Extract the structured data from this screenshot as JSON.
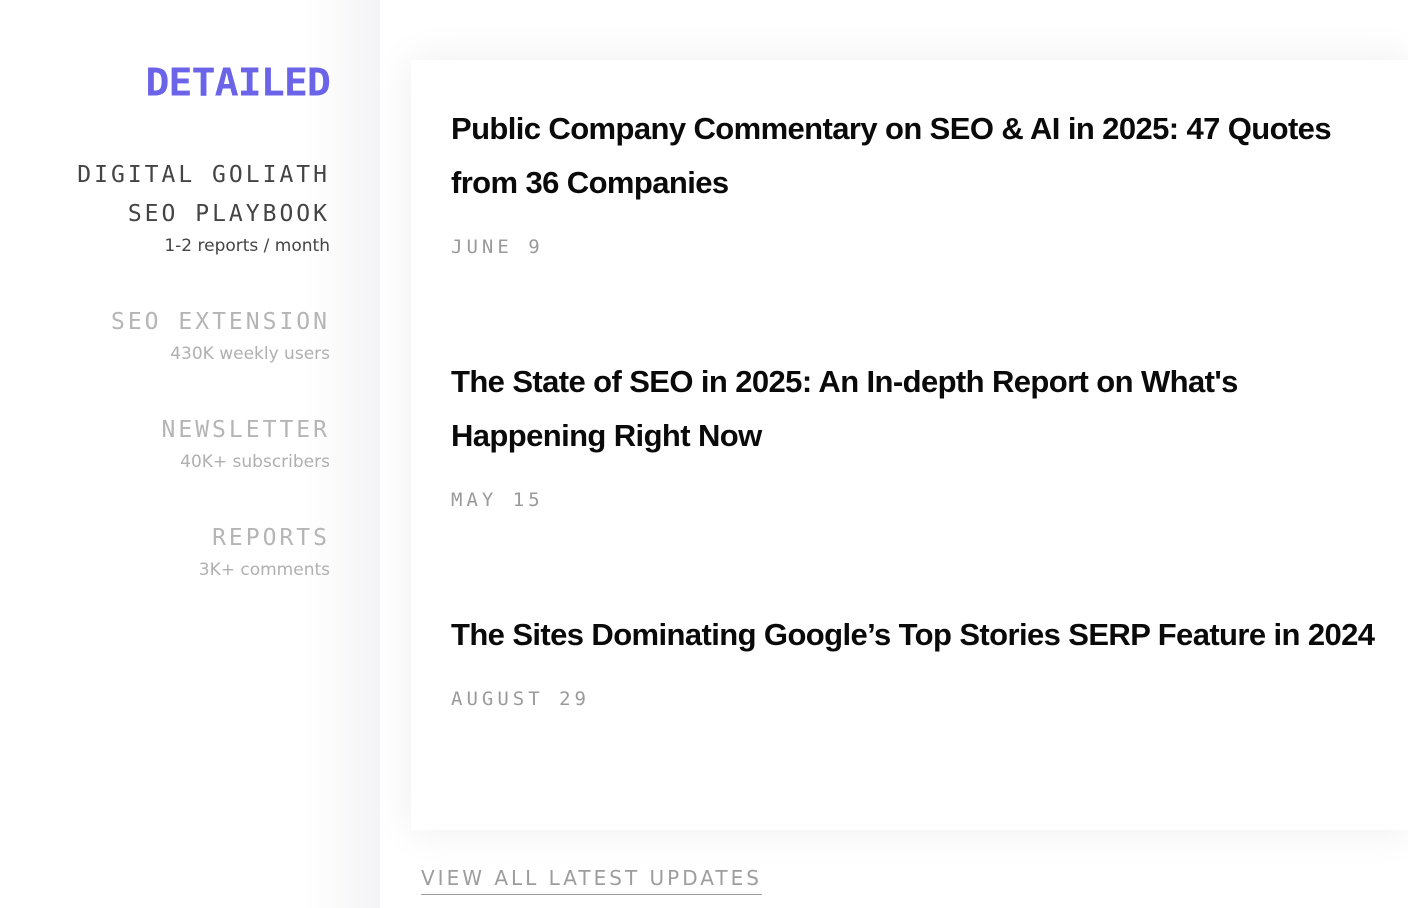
{
  "brand": {
    "logo_text": "DETAILED",
    "accent_color": "#6b63e8"
  },
  "sidebar": {
    "items": [
      {
        "title": "DIGITAL GOLIATH SEO PLAYBOOK",
        "subtitle": "1-2 reports / month",
        "active": true
      },
      {
        "title": "SEO EXTENSION",
        "subtitle": "430K weekly users",
        "active": false
      },
      {
        "title": "NEWSLETTER",
        "subtitle": "40K+ subscribers",
        "active": false
      },
      {
        "title": "REPORTS",
        "subtitle": "3K+ comments",
        "active": false
      }
    ]
  },
  "posts": [
    {
      "title": "Public Company Commentary on SEO & AI in 2025: 47 Quotes from 36 Companies",
      "date": "JUNE 9"
    },
    {
      "title": "The State of SEO in 2025: An In-depth Report on What's Happening Right Now",
      "date": "MAY 15"
    },
    {
      "title": "The Sites Dominating Google’s Top Stories SERP Feature in 2024",
      "date": "AUGUST 29"
    }
  ],
  "footer": {
    "view_all_label": "VIEW ALL LATEST UPDATES"
  }
}
